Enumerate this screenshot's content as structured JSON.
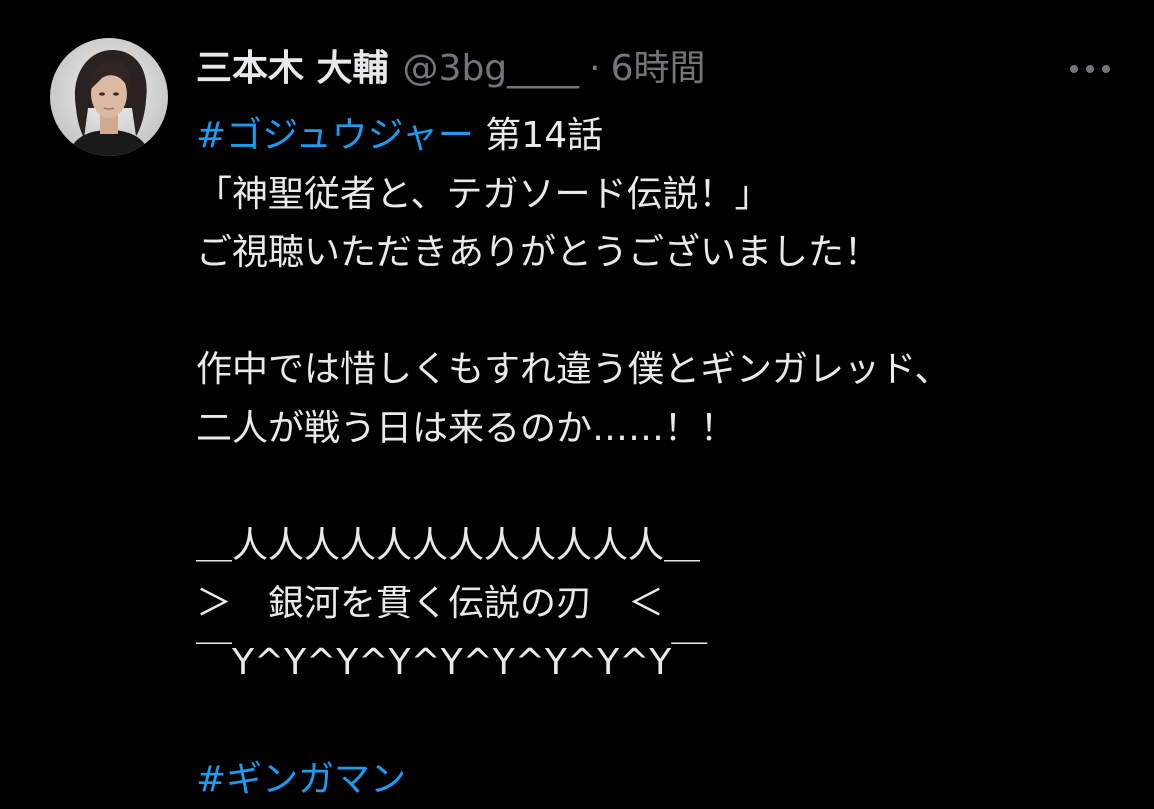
{
  "colors": {
    "background": "#000000",
    "text": "#e7e9ea",
    "muted": "#71767b",
    "link": "#1d9bf0"
  },
  "author": {
    "display_name": "三本木 大輔",
    "handle": "@3bg____",
    "separator": "·",
    "time": "6時間"
  },
  "more_icon": "more-horizontal-icon",
  "tweet": {
    "line1_hashtag": "#ゴジュウジャー",
    "line1_text": " 第14話",
    "line2": "「神聖従者と、テガソード伝説！」",
    "line3": "ご視聴いただきありがとうございました！",
    "line4": "作中では惜しくもすれ違う僕とギンガレッド、",
    "line5": "二人が戦う日は来るのか……！！",
    "line6": "＿人人人人人人人人人人人人＿",
    "line7": "＞　銀河を貫く伝説の刃　＜",
    "line8": "￣Y^Y^Y^Y^Y^Y^Y^Y^Y￣",
    "line9_hashtag": "#ギンガマン"
  }
}
